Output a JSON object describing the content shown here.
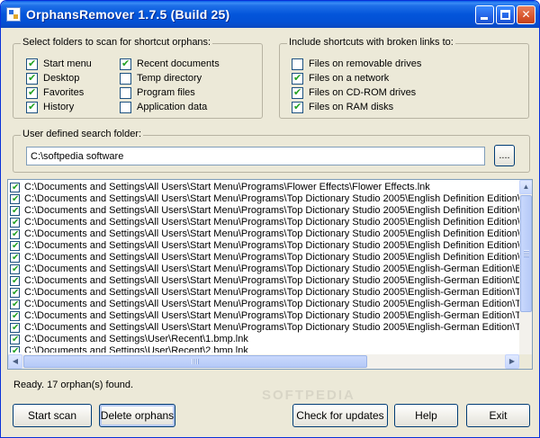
{
  "window": {
    "title": "OrphansRemover 1.7.5 (Build 25)"
  },
  "folders_group": {
    "label": "Select folders to scan for shortcut orphans:",
    "options": [
      {
        "label": "Start menu",
        "checked": true
      },
      {
        "label": "Desktop",
        "checked": true
      },
      {
        "label": "Favorites",
        "checked": true
      },
      {
        "label": "History",
        "checked": true
      },
      {
        "label": "Recent documents",
        "checked": true
      },
      {
        "label": "Temp directory",
        "checked": false
      },
      {
        "label": "Program files",
        "checked": false
      },
      {
        "label": "Application data",
        "checked": false
      }
    ]
  },
  "broken_group": {
    "label": "Include shortcuts with broken links to:",
    "options": [
      {
        "label": "Files on removable drives",
        "checked": false
      },
      {
        "label": "Files on a network",
        "checked": true
      },
      {
        "label": "Files on CD-ROM drives",
        "checked": true
      },
      {
        "label": "Files on RAM disks",
        "checked": true
      }
    ]
  },
  "user_folder": {
    "label": "User defined search folder:",
    "value": "C:\\softpedia software",
    "browse_label": "...."
  },
  "results": [
    {
      "path": "C:\\Documents and Settings\\All Users\\Start Menu\\Programs\\Flower Effects\\Flower Effects.lnk",
      "checked": true
    },
    {
      "path": "C:\\Documents and Settings\\All Users\\Start Menu\\Programs\\Top Dictionary Studio 2005\\English Definition Edition\\B",
      "checked": true
    },
    {
      "path": "C:\\Documents and Settings\\All Users\\Start Menu\\Programs\\Top Dictionary Studio 2005\\English Definition Edition\\D",
      "checked": true
    },
    {
      "path": "C:\\Documents and Settings\\All Users\\Start Menu\\Programs\\Top Dictionary Studio 2005\\English Definition Edition\\T",
      "checked": true
    },
    {
      "path": "C:\\Documents and Settings\\All Users\\Start Menu\\Programs\\Top Dictionary Studio 2005\\English Definition Edition\\T",
      "checked": true
    },
    {
      "path": "C:\\Documents and Settings\\All Users\\Start Menu\\Programs\\Top Dictionary Studio 2005\\English Definition Edition\\T",
      "checked": true
    },
    {
      "path": "C:\\Documents and Settings\\All Users\\Start Menu\\Programs\\Top Dictionary Studio 2005\\English Definition Edition\\T",
      "checked": true
    },
    {
      "path": "C:\\Documents and Settings\\All Users\\Start Menu\\Programs\\Top Dictionary Studio 2005\\English-German Edition\\Bu",
      "checked": true
    },
    {
      "path": "C:\\Documents and Settings\\All Users\\Start Menu\\Programs\\Top Dictionary Studio 2005\\English-German Edition\\Do",
      "checked": true
    },
    {
      "path": "C:\\Documents and Settings\\All Users\\Start Menu\\Programs\\Top Dictionary Studio 2005\\English-German Edition\\To",
      "checked": true
    },
    {
      "path": "C:\\Documents and Settings\\All Users\\Start Menu\\Programs\\Top Dictionary Studio 2005\\English-German Edition\\To",
      "checked": true
    },
    {
      "path": "C:\\Documents and Settings\\All Users\\Start Menu\\Programs\\Top Dictionary Studio 2005\\English-German Edition\\To",
      "checked": true
    },
    {
      "path": "C:\\Documents and Settings\\All Users\\Start Menu\\Programs\\Top Dictionary Studio 2005\\English-German Edition\\To",
      "checked": true
    },
    {
      "path": "C:\\Documents and Settings\\User\\Recent\\1.bmp.lnk",
      "checked": true
    },
    {
      "path": "C:\\Documents and Settings\\User\\Recent\\2.bmp.lnk",
      "checked": true
    }
  ],
  "status": {
    "text": "Ready. 17 orphan(s) found."
  },
  "watermark": "SOFTPEDIA",
  "buttons": {
    "start_scan": "Start scan",
    "delete_orphans": "Delete orphans",
    "check_updates": "Check for updates",
    "help": "Help",
    "exit": "Exit"
  },
  "colors": {
    "titlebar": "#0355da",
    "window_bg": "#ece9d8",
    "check_mark": "#21a121"
  }
}
